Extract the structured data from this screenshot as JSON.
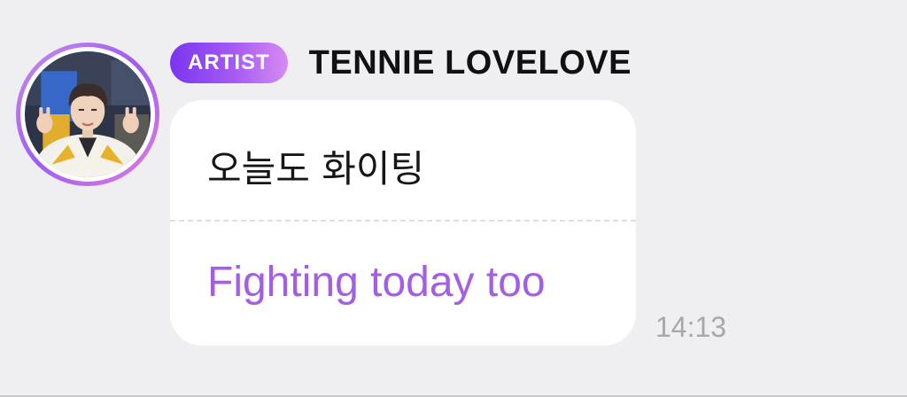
{
  "message": {
    "badge_label": "ARTIST",
    "sender_name": "TENNIE LOVELOVE",
    "original_text": "오늘도 화이팅",
    "translated_text": "Fighting today too",
    "time": "14:13"
  },
  "avatar": {
    "icon": "profile-photo"
  },
  "colors": {
    "background": "#efeff1",
    "bubble": "#ffffff",
    "badge_gradient_start": "#7a35f0",
    "badge_gradient_end": "#d68bf2",
    "translated_text": "#a45ee6",
    "time_text": "#a6a6ac"
  }
}
